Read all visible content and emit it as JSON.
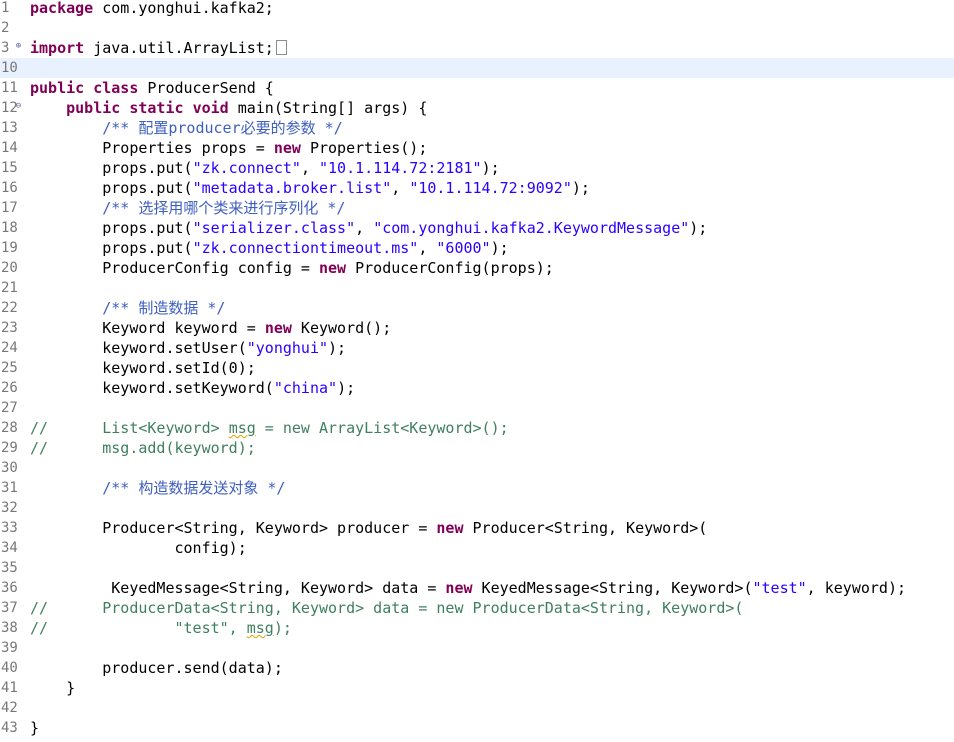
{
  "editor": {
    "language": "java",
    "current_line": "10",
    "colors": {
      "keyword": "#7f0055",
      "string": "#2a00ff",
      "javadoc": "#3f5fbf",
      "comment": "#3f7f5f",
      "line_number": "#787878",
      "current_line_bg": "#e8f2fe"
    },
    "lines": [
      {
        "num": "1",
        "t": [
          {
            "k": "kw",
            "v": "package"
          },
          {
            "k": "plain",
            "v": " com.yonghui.kafka2;"
          }
        ]
      },
      {
        "num": "2",
        "t": []
      },
      {
        "num": "3",
        "fold": "plus",
        "collapsed": true,
        "t": [
          {
            "k": "kw",
            "v": "import"
          },
          {
            "k": "plain",
            "v": " java.util.ArrayList;"
          }
        ]
      },
      {
        "num": "10",
        "current": true,
        "t": []
      },
      {
        "num": "11",
        "t": [
          {
            "k": "kw",
            "v": "public"
          },
          {
            "k": "plain",
            "v": " "
          },
          {
            "k": "kw",
            "v": "class"
          },
          {
            "k": "plain",
            "v": " ProducerSend {"
          }
        ]
      },
      {
        "num": "12",
        "fold": "minus",
        "t": [
          {
            "k": "plain",
            "v": "    "
          },
          {
            "k": "kw",
            "v": "public"
          },
          {
            "k": "plain",
            "v": " "
          },
          {
            "k": "kw",
            "v": "static"
          },
          {
            "k": "plain",
            "v": " "
          },
          {
            "k": "kw",
            "v": "void"
          },
          {
            "k": "plain",
            "v": " main(String[] args) {"
          }
        ]
      },
      {
        "num": "13",
        "t": [
          {
            "k": "plain",
            "v": "        "
          },
          {
            "k": "jdoc",
            "v": "/** 配置producer必要的参数 */"
          }
        ]
      },
      {
        "num": "14",
        "t": [
          {
            "k": "plain",
            "v": "        Properties props = "
          },
          {
            "k": "kw",
            "v": "new"
          },
          {
            "k": "plain",
            "v": " Properties();"
          }
        ]
      },
      {
        "num": "15",
        "t": [
          {
            "k": "plain",
            "v": "        props.put("
          },
          {
            "k": "str",
            "v": "\"zk.connect\""
          },
          {
            "k": "plain",
            "v": ", "
          },
          {
            "k": "str",
            "v": "\"10.1.114.72:2181\""
          },
          {
            "k": "plain",
            "v": ");"
          }
        ]
      },
      {
        "num": "16",
        "t": [
          {
            "k": "plain",
            "v": "        props.put("
          },
          {
            "k": "str",
            "v": "\"metadata.broker.list\""
          },
          {
            "k": "plain",
            "v": ", "
          },
          {
            "k": "str",
            "v": "\"10.1.114.72:9092\""
          },
          {
            "k": "plain",
            "v": ");"
          }
        ]
      },
      {
        "num": "17",
        "t": [
          {
            "k": "plain",
            "v": "        "
          },
          {
            "k": "jdoc",
            "v": "/** 选择用哪个类来进行序列化 */"
          }
        ]
      },
      {
        "num": "18",
        "t": [
          {
            "k": "plain",
            "v": "        props.put("
          },
          {
            "k": "str",
            "v": "\"serializer.class\""
          },
          {
            "k": "plain",
            "v": ", "
          },
          {
            "k": "str",
            "v": "\"com.yonghui.kafka2.KeywordMessage\""
          },
          {
            "k": "plain",
            "v": ");"
          }
        ]
      },
      {
        "num": "19",
        "t": [
          {
            "k": "plain",
            "v": "        props.put("
          },
          {
            "k": "str",
            "v": "\"zk.connectiontimeout.ms\""
          },
          {
            "k": "plain",
            "v": ", "
          },
          {
            "k": "str",
            "v": "\"6000\""
          },
          {
            "k": "plain",
            "v": ");"
          }
        ]
      },
      {
        "num": "20",
        "t": [
          {
            "k": "plain",
            "v": "        ProducerConfig config = "
          },
          {
            "k": "kw",
            "v": "new"
          },
          {
            "k": "plain",
            "v": " ProducerConfig(props);"
          }
        ]
      },
      {
        "num": "21",
        "t": []
      },
      {
        "num": "22",
        "t": [
          {
            "k": "plain",
            "v": "        "
          },
          {
            "k": "jdoc",
            "v": "/** 制造数据 */"
          }
        ]
      },
      {
        "num": "23",
        "t": [
          {
            "k": "plain",
            "v": "        Keyword keyword = "
          },
          {
            "k": "kw",
            "v": "new"
          },
          {
            "k": "plain",
            "v": " Keyword();"
          }
        ]
      },
      {
        "num": "24",
        "t": [
          {
            "k": "plain",
            "v": "        keyword.setUser("
          },
          {
            "k": "str",
            "v": "\"yonghui\""
          },
          {
            "k": "plain",
            "v": ");"
          }
        ]
      },
      {
        "num": "25",
        "t": [
          {
            "k": "plain",
            "v": "        keyword.setId(0);"
          }
        ]
      },
      {
        "num": "26",
        "t": [
          {
            "k": "plain",
            "v": "        keyword.setKeyword("
          },
          {
            "k": "str",
            "v": "\"china\""
          },
          {
            "k": "plain",
            "v": ");"
          }
        ]
      },
      {
        "num": "27",
        "t": []
      },
      {
        "num": "28",
        "t": [
          {
            "k": "cmt",
            "v": "//      List<Keyword> "
          },
          {
            "k": "cmt squig",
            "v": "msg"
          },
          {
            "k": "cmt",
            "v": " = new ArrayList<Keyword>();"
          }
        ]
      },
      {
        "num": "29",
        "t": [
          {
            "k": "cmt",
            "v": "//      msg.add(keyword);"
          }
        ]
      },
      {
        "num": "30",
        "t": []
      },
      {
        "num": "31",
        "t": [
          {
            "k": "plain",
            "v": "        "
          },
          {
            "k": "jdoc",
            "v": "/** 构造数据发送对象 */"
          }
        ]
      },
      {
        "num": "32",
        "t": []
      },
      {
        "num": "33",
        "t": [
          {
            "k": "plain",
            "v": "        Producer<String, Keyword> producer = "
          },
          {
            "k": "kw",
            "v": "new"
          },
          {
            "k": "plain",
            "v": " Producer<String, Keyword>("
          }
        ]
      },
      {
        "num": "34",
        "t": [
          {
            "k": "plain",
            "v": "                config);"
          }
        ]
      },
      {
        "num": "35",
        "t": []
      },
      {
        "num": "36",
        "t": [
          {
            "k": "plain",
            "v": "         KeyedMessage<String, Keyword> data = "
          },
          {
            "k": "kw",
            "v": "new"
          },
          {
            "k": "plain",
            "v": " KeyedMessage<String, Keyword>("
          },
          {
            "k": "str",
            "v": "\"test\""
          },
          {
            "k": "plain",
            "v": ", keyword);"
          }
        ]
      },
      {
        "num": "37",
        "t": [
          {
            "k": "cmt",
            "v": "//      ProducerData<String, Keyword> data = new ProducerData<String, Keyword>("
          }
        ]
      },
      {
        "num": "38",
        "t": [
          {
            "k": "cmt",
            "v": "//              \"test\", "
          },
          {
            "k": "cmt squig",
            "v": "msg"
          },
          {
            "k": "cmt",
            "v": ");"
          }
        ]
      },
      {
        "num": "39",
        "t": []
      },
      {
        "num": "40",
        "t": [
          {
            "k": "plain",
            "v": "        producer.send(data);"
          }
        ]
      },
      {
        "num": "41",
        "t": [
          {
            "k": "plain",
            "v": "    }"
          }
        ]
      },
      {
        "num": "42",
        "t": []
      },
      {
        "num": "43",
        "t": [
          {
            "k": "plain",
            "v": "}"
          }
        ]
      }
    ]
  }
}
